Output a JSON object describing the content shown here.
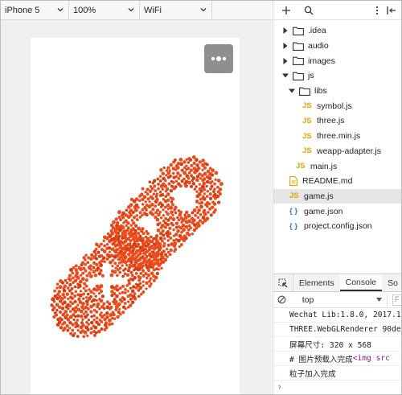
{
  "simulator": {
    "device": "iPhone 5",
    "zoom": "100%",
    "network": "WiFi"
  },
  "file_tree": [
    {
      "name": ".idea",
      "type": "folder",
      "expanded": false
    },
    {
      "name": "audio",
      "type": "folder",
      "expanded": false
    },
    {
      "name": "images",
      "type": "folder",
      "expanded": false
    },
    {
      "name": "js",
      "type": "folder",
      "expanded": true
    },
    {
      "name": "libs",
      "type": "folder",
      "expanded": true
    },
    {
      "name": "symbol.js",
      "type": "js"
    },
    {
      "name": "three.js",
      "type": "js"
    },
    {
      "name": "three.min.js",
      "type": "js"
    },
    {
      "name": "weapp-adapter.js",
      "type": "js"
    },
    {
      "name": "main.js",
      "type": "js"
    },
    {
      "name": "README.md",
      "type": "doc"
    },
    {
      "name": "game.js",
      "type": "js",
      "selected": true
    },
    {
      "name": "game.json",
      "type": "json"
    },
    {
      "name": "project.config.json",
      "type": "json"
    }
  ],
  "file_type_tags": {
    "js": "JS",
    "json": "{ }"
  },
  "devtools": {
    "tabs": [
      "Elements",
      "Console",
      "So"
    ],
    "active_tab": "Console",
    "context": "top",
    "filter_placeholder": "F",
    "console": [
      {
        "text": "Wechat Lib:1.8.0, 2017.1"
      },
      {
        "text": "THREE.WebGLRenderer 90de"
      },
      {
        "text": "屏幕尺寸: 320 x 568"
      },
      {
        "text": "# 图片预载入完成  ",
        "tag": "<img src"
      },
      {
        "text": "粒子加入完成"
      }
    ],
    "prompt": "›"
  },
  "colors": {
    "particle": "#ec4a1a",
    "particle_dark": "#d83c12",
    "menu_button": "#8f8f8f",
    "js_tag": "#e9a300",
    "json_tag": "#2a7be0"
  }
}
